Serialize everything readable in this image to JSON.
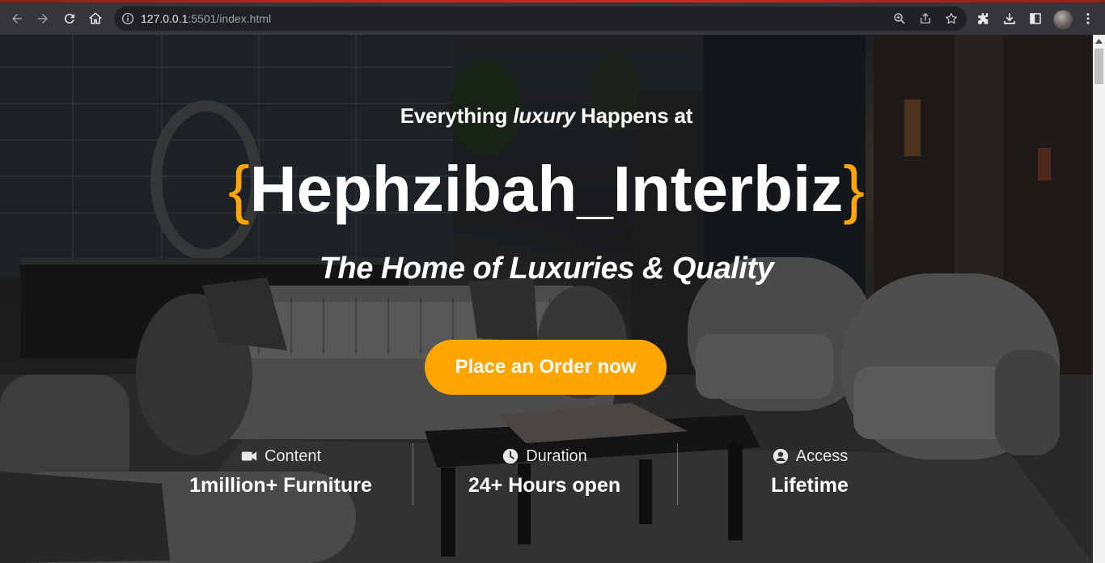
{
  "browser": {
    "url_host": "127.0.0.1",
    "url_rest": ":5501/index.html"
  },
  "hero": {
    "pre_text": "Everything",
    "pre_italic": "luxury",
    "pre_after": "Happens at",
    "brace_open": "{",
    "brand": "Hephzibah_Interbiz",
    "brace_close": "}",
    "tagline": "The Home of Luxuries & Quality",
    "cta_label": "Place an Order now"
  },
  "stats": [
    {
      "icon": "video-camera-icon",
      "label": "Content",
      "value": "1million+ Furniture"
    },
    {
      "icon": "clock-icon",
      "label": "Duration",
      "value": "24+ Hours open"
    },
    {
      "icon": "user-circle-icon",
      "label": "Access",
      "value": "Lifetime"
    }
  ],
  "colors": {
    "accent": "#ffa500",
    "chrome": "#35363a",
    "omnibox": "#202124"
  }
}
